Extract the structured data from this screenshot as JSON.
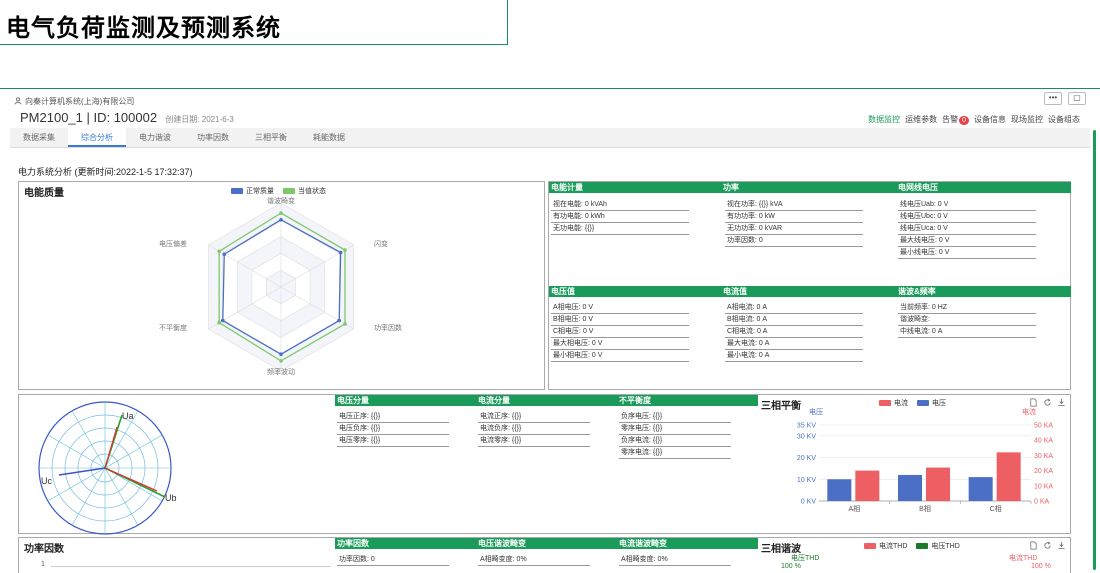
{
  "slide": {
    "title": "电气负荷监测及预测系统"
  },
  "header": {
    "company": "向秦计算机系统(上海)有限公司",
    "device": "PM2100_1 | ID: 100002",
    "created": "创建日期: 2021-6-3",
    "more_btn": "•••",
    "window_btn": "▢",
    "nav": {
      "monitor": "数据监控",
      "params": "运维参数",
      "alarm": "告警",
      "alarm_count": "0",
      "info": "设备信息",
      "site": "现场监控",
      "config": "设备组态"
    }
  },
  "tabs": [
    "数据采集",
    "综合分析",
    "电力谐波",
    "功率因数",
    "三相平衡",
    "耗能数据"
  ],
  "analysis": {
    "title": "电力系统分析 (更新时间:2022-1-5 17:32:37)"
  },
  "power_quality": {
    "title": "电能质量",
    "legend": [
      "正常质量",
      "当值状态"
    ],
    "axes": [
      "谐波畸变",
      "闪变",
      "功率因数",
      "频率波动",
      "不平衡度",
      "电压偏差"
    ]
  },
  "energy": {
    "head": "电能计量",
    "items": [
      "视在电能: 0 kVAh",
      "有功电能: 0 kWh",
      "无功电能: {{}}"
    ]
  },
  "power": {
    "head": "功率",
    "items": [
      "视在功率: {{}} kVA",
      "有功功率: 0 kW",
      "无功功率: 0 kVAR",
      "功率因数: 0"
    ]
  },
  "line_voltage": {
    "head": "电网线电压",
    "items": [
      "线电压Uab: 0 V",
      "线电压Ubc: 0 V",
      "线电压Uca: 0 V",
      "最大线电压: 0 V",
      "最小线电压: 0 V"
    ]
  },
  "voltage": {
    "head": "电压值",
    "items": [
      "A相电压: 0 V",
      "B相电压: 0 V",
      "C相电压: 0 V",
      "最大相电压: 0 V",
      "最小相电压: 0 V"
    ]
  },
  "current": {
    "head": "电流值",
    "items": [
      "A相电流: 0 A",
      "B相电流: 0 A",
      "C相电流: 0 A",
      "最大电流: 0 A",
      "最小电流: 0 A"
    ]
  },
  "harmonic_freq": {
    "head": "谐波&频率",
    "items": [
      "当前频率: 0 HZ",
      "谐波畸变:",
      "中线电流: 0 A"
    ]
  },
  "phasor": {
    "labels": [
      "Ua",
      "Uc",
      "Ub"
    ]
  },
  "volt_comp": {
    "head": "电压分量",
    "items": [
      "电压正序: {{}}",
      "电压负序: {{}}",
      "电压零序: {{}}"
    ]
  },
  "curr_comp": {
    "head": "电流分量",
    "items": [
      "电流正序: {{}}",
      "电流负序: {{}}",
      "电流零序: {{}}"
    ]
  },
  "unbalance": {
    "head": "不平衡度",
    "items": [
      "负序电压: {{}}",
      "零序电压: {{}}",
      "负序电流: {{}}",
      "零序电流: {{}}"
    ]
  },
  "three_phase": {
    "title": "三相平衡",
    "legend": [
      "电流",
      "电压"
    ],
    "left_unit": "电压",
    "right_unit": "电流"
  },
  "pf": {
    "title": "功率因数",
    "axis_label": "1"
  },
  "pf_box": {
    "head": "功率因数",
    "items": [
      "功率因数: 0"
    ]
  },
  "v_thd": {
    "head": "电压谐波畸变",
    "items": [
      "A相畸变度: 0%"
    ]
  },
  "i_thd": {
    "head": "电流谐波畸变",
    "items": [
      "A相畸变度: 0%"
    ]
  },
  "harmonics": {
    "title": "三相谐波",
    "legend": [
      "电流THD",
      "电压THD"
    ],
    "left_unit": "电压THD",
    "right_unit": "电流THD",
    "left_top": "100 %",
    "right_top": "100 %"
  },
  "colors": {
    "green": "#1a9b5a",
    "blue": "#4a6fc4",
    "red": "#ee5f64",
    "lightgreen": "#7dc96a"
  },
  "chart_data": [
    {
      "type": "radar",
      "title": "电能质量",
      "categories": [
        "谐波畸变",
        "闪变",
        "功率因数",
        "频率波动",
        "不平衡度",
        "电压偏差"
      ],
      "series": [
        {
          "name": "正常质量",
          "values": [
            0.8,
            0.82,
            0.8,
            0.8,
            0.8,
            0.78
          ]
        },
        {
          "name": "当值状态",
          "values": [
            0.88,
            0.88,
            0.88,
            0.88,
            0.85,
            0.85
          ]
        }
      ],
      "range": [
        0,
        1
      ]
    },
    {
      "type": "bar",
      "title": "三相平衡",
      "categories": [
        "A相",
        "B相",
        "C相"
      ],
      "series": [
        {
          "name": "电压",
          "axis": "left",
          "values": [
            10,
            12,
            11
          ]
        },
        {
          "name": "电流",
          "axis": "right",
          "values": [
            20,
            22,
            32
          ]
        }
      ],
      "left_ticks": [
        "0 KV",
        "10 KV",
        "20 KV",
        "30 KV",
        "35 KV"
      ],
      "left_tick_values": [
        0,
        10,
        20,
        30,
        35
      ],
      "right_ticks": [
        "0 KA",
        "10 KA",
        "20 KA",
        "30 KA",
        "40 KA",
        "50 KA"
      ],
      "right_tick_values": [
        0,
        10,
        20,
        30,
        40,
        50
      ],
      "ylim_left": [
        0,
        35
      ],
      "ylim_right": [
        0,
        50
      ]
    }
  ]
}
